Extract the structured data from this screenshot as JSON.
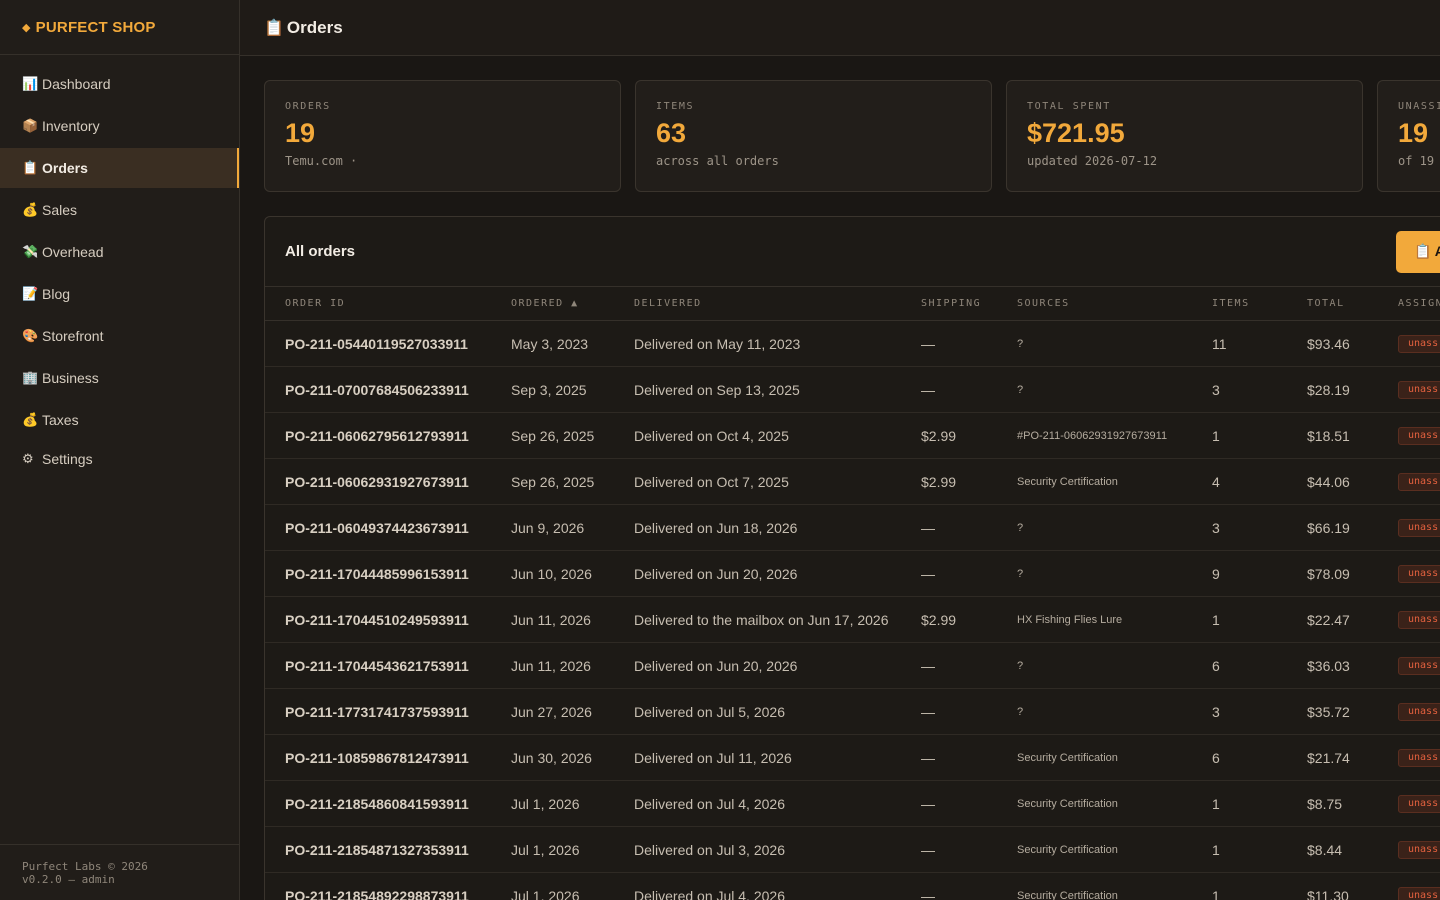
{
  "brand": {
    "icon": "◆",
    "name": "PURFECT SHOP"
  },
  "nav": [
    {
      "icon": "📊",
      "label": "Dashboard",
      "name": "sidebar-item-dashboard",
      "icon_name": "chart-icon"
    },
    {
      "icon": "📦",
      "label": "Inventory",
      "name": "sidebar-item-inventory",
      "icon_name": "package-icon"
    },
    {
      "icon": "📋",
      "label": "Orders",
      "name": "sidebar-item-orders",
      "icon_name": "clipboard-icon",
      "active": true
    },
    {
      "icon": "💰",
      "label": "Sales",
      "name": "sidebar-item-sales",
      "icon_name": "money-bag-icon"
    },
    {
      "icon": "💸",
      "label": "Overhead",
      "name": "sidebar-item-overhead",
      "icon_name": "money-wings-icon"
    },
    {
      "icon": "📝",
      "label": "Blog",
      "name": "sidebar-item-blog",
      "icon_name": "memo-icon"
    },
    {
      "icon": "🎨",
      "label": "Storefront",
      "name": "sidebar-item-storefront",
      "icon_name": "palette-icon"
    },
    {
      "icon": "🏢",
      "label": "Business",
      "name": "sidebar-item-business",
      "icon_name": "office-building-icon"
    },
    {
      "icon": "💰",
      "label": "Taxes",
      "name": "sidebar-item-taxes",
      "icon_name": "money-bag-icon"
    },
    {
      "icon": "⚙",
      "label": "Settings",
      "name": "sidebar-item-settings",
      "icon_name": "gear-icon"
    }
  ],
  "footer": {
    "line1": "Purfect Labs © 2026",
    "line2": "v0.2.0 — admin"
  },
  "header": {
    "icon": "📋",
    "title": "Orders"
  },
  "stats": [
    {
      "label": "ORDERS",
      "value": "19",
      "sub": "Temu.com ·"
    },
    {
      "label": "ITEMS",
      "value": "63",
      "sub": "across all orders"
    },
    {
      "label": "TOTAL SPENT",
      "value": "$721.95",
      "sub": "updated 2026-07-12"
    },
    {
      "label": "UNASSI",
      "value": "19",
      "sub": "of 19"
    }
  ],
  "table": {
    "title": "All orders",
    "action_button": "📋 A",
    "columns": {
      "order_id": "ORDER ID",
      "ordered": "ORDERED ▲",
      "delivered": "DELIVERED",
      "shipping": "SHIPPING",
      "sources": "SOURCES",
      "items": "ITEMS",
      "total": "TOTAL",
      "assign": "ASSIGN"
    },
    "badge_label": "unass",
    "rows": [
      {
        "id": "PO-211-05440119527033911",
        "ordered": "May 3, 2023",
        "delivered": "Delivered on May 11, 2023",
        "shipping": "—",
        "sources": "?",
        "items": "11",
        "total": "$93.46"
      },
      {
        "id": "PO-211-07007684506233911",
        "ordered": "Sep 3, 2025",
        "delivered": "Delivered on Sep 13, 2025",
        "shipping": "—",
        "sources": "?",
        "items": "3",
        "total": "$28.19"
      },
      {
        "id": "PO-211-06062795612793911",
        "ordered": "Sep 26, 2025",
        "delivered": "Delivered on Oct 4, 2025",
        "shipping": "$2.99",
        "sources": "#PO-211-06062931927673911",
        "items": "1",
        "total": "$18.51"
      },
      {
        "id": "PO-211-06062931927673911",
        "ordered": "Sep 26, 2025",
        "delivered": "Delivered on Oct 7, 2025",
        "shipping": "$2.99",
        "sources": "Security Certification",
        "items": "4",
        "total": "$44.06"
      },
      {
        "id": "PO-211-06049374423673911",
        "ordered": "Jun 9, 2026",
        "delivered": "Delivered on Jun 18, 2026",
        "shipping": "—",
        "sources": "?",
        "items": "3",
        "total": "$66.19"
      },
      {
        "id": "PO-211-17044485996153911",
        "ordered": "Jun 10, 2026",
        "delivered": "Delivered on Jun 20, 2026",
        "shipping": "—",
        "sources": "?",
        "items": "9",
        "total": "$78.09"
      },
      {
        "id": "PO-211-17044510249593911",
        "ordered": "Jun 11, 2026",
        "delivered": "Delivered to the mailbox on Jun 17, 2026",
        "shipping": "$2.99",
        "sources": "HX Fishing Flies Lure",
        "items": "1",
        "total": "$22.47"
      },
      {
        "id": "PO-211-17044543621753911",
        "ordered": "Jun 11, 2026",
        "delivered": "Delivered on Jun 20, 2026",
        "shipping": "—",
        "sources": "?",
        "items": "6",
        "total": "$36.03"
      },
      {
        "id": "PO-211-17731741737593911",
        "ordered": "Jun 27, 2026",
        "delivered": "Delivered on Jul 5, 2026",
        "shipping": "—",
        "sources": "?",
        "items": "3",
        "total": "$35.72"
      },
      {
        "id": "PO-211-10859867812473911",
        "ordered": "Jun 30, 2026",
        "delivered": "Delivered on Jul 11, 2026",
        "shipping": "—",
        "sources": "Security Certification",
        "items": "6",
        "total": "$21.74"
      },
      {
        "id": "PO-211-21854860841593911",
        "ordered": "Jul 1, 2026",
        "delivered": "Delivered on Jul 4, 2026",
        "shipping": "—",
        "sources": "Security Certification",
        "items": "1",
        "total": "$8.75"
      },
      {
        "id": "PO-211-21854871327353911",
        "ordered": "Jul 1, 2026",
        "delivered": "Delivered on Jul 3, 2026",
        "shipping": "—",
        "sources": "Security Certification",
        "items": "1",
        "total": "$8.44"
      },
      {
        "id": "PO-211-21854892298873911",
        "ordered": "Jul 1, 2026",
        "delivered": "Delivered on Jul 4, 2026",
        "shipping": "—",
        "sources": "Security Certification",
        "items": "1",
        "total": "$11.30"
      }
    ]
  },
  "colors": {
    "accent": "#f2a93b",
    "background": "#1a1714",
    "badge_text": "#e2603e"
  }
}
